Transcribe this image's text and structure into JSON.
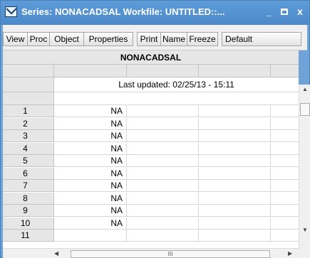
{
  "window": {
    "title": "Series: NONACADSAL   Workfile: UNTITLED::...",
    "minimize": "_",
    "close": "x"
  },
  "toolbar": {
    "view": "View",
    "proc": "Proc",
    "object": "Object",
    "properties": "Properties",
    "print": "Print",
    "name": "Name",
    "freeze": "Freeze",
    "default": "Default"
  },
  "sheet": {
    "series_name": "NONACADSAL",
    "last_updated": "Last updated: 02/25/13 - 15:11",
    "rows": [
      {
        "index": "1",
        "value": "NA"
      },
      {
        "index": "2",
        "value": "NA"
      },
      {
        "index": "3",
        "value": "NA"
      },
      {
        "index": "4",
        "value": "NA"
      },
      {
        "index": "5",
        "value": "NA"
      },
      {
        "index": "6",
        "value": "NA"
      },
      {
        "index": "7",
        "value": "NA"
      },
      {
        "index": "8",
        "value": "NA"
      },
      {
        "index": "9",
        "value": "NA"
      },
      {
        "index": "10",
        "value": "NA"
      },
      {
        "index": "11",
        "value": ""
      }
    ]
  },
  "scroll": {
    "up": "▲",
    "down": "▼",
    "left": "◀",
    "right": "▶",
    "thumb_grip": "III"
  }
}
